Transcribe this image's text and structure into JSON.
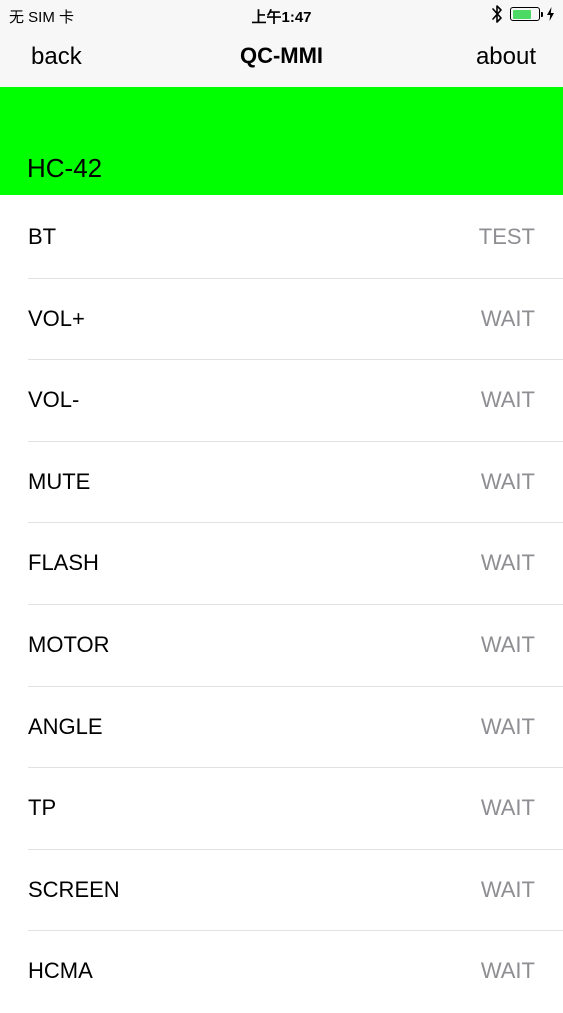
{
  "status_bar": {
    "carrier": "无 SIM 卡",
    "time": "上午1:47",
    "battery_level": 0.75,
    "battery_color": "#4cd964"
  },
  "nav": {
    "back_label": "back",
    "title": "QC-MMI",
    "about_label": "about"
  },
  "device": {
    "name": "HC-42",
    "header_color": "#00ff00"
  },
  "tests": [
    {
      "name": "BT",
      "status": "TEST"
    },
    {
      "name": "VOL+",
      "status": "WAIT"
    },
    {
      "name": "VOL-",
      "status": "WAIT"
    },
    {
      "name": "MUTE",
      "status": "WAIT"
    },
    {
      "name": "FLASH",
      "status": "WAIT"
    },
    {
      "name": "MOTOR",
      "status": "WAIT"
    },
    {
      "name": "ANGLE",
      "status": "WAIT"
    },
    {
      "name": "TP",
      "status": "WAIT"
    },
    {
      "name": "SCREEN",
      "status": "WAIT"
    },
    {
      "name": "HCMA",
      "status": "WAIT"
    }
  ]
}
